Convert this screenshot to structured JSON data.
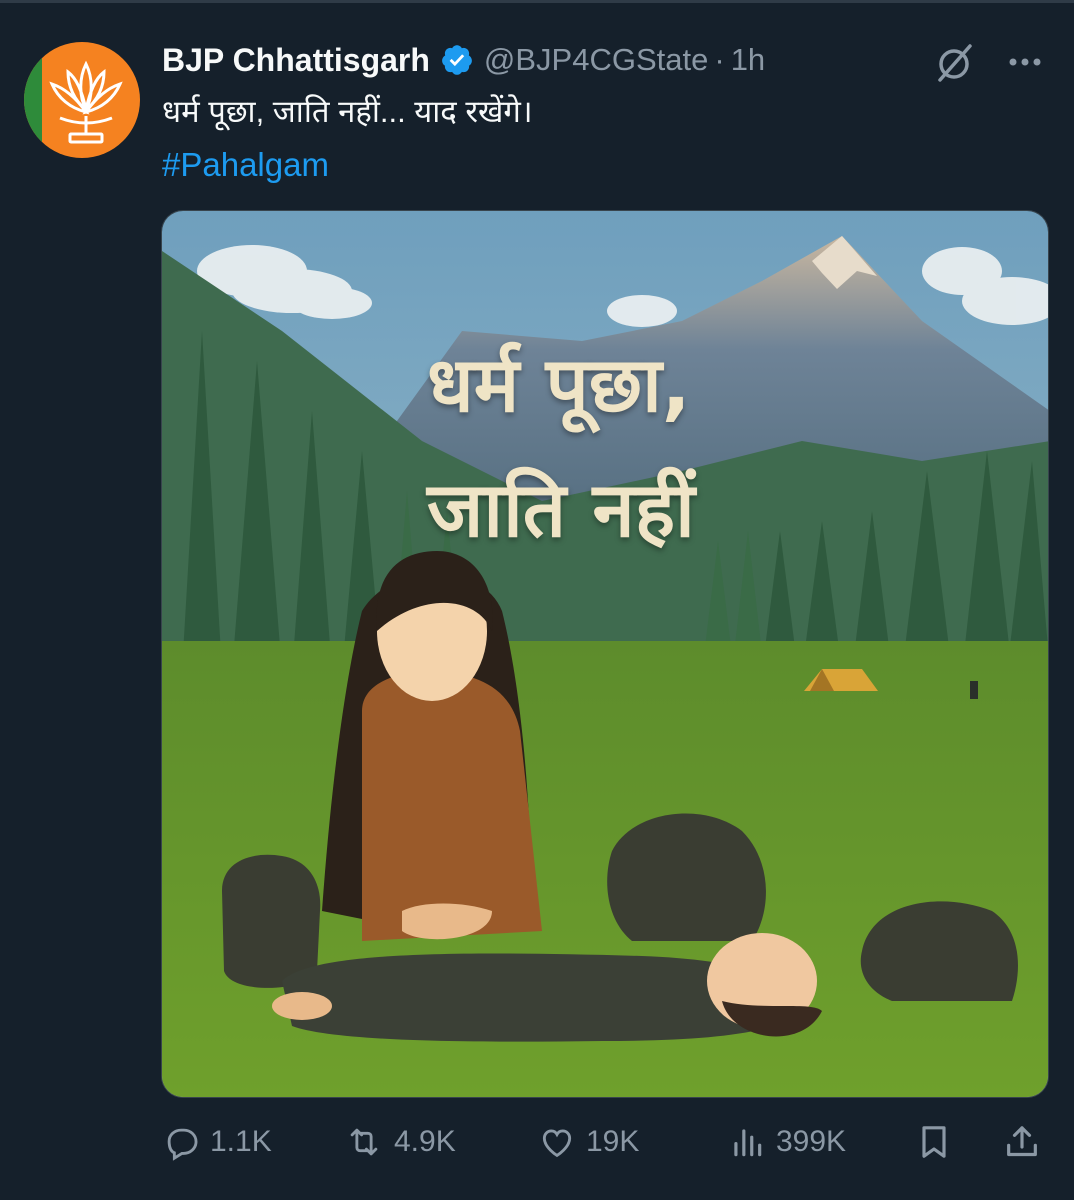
{
  "account": {
    "display_name": "BJP Chhattisgarh",
    "handle": "@BJP4CGState",
    "separator": "·",
    "time_ago": "1h",
    "verified": true
  },
  "tweet": {
    "text": "धर्म पूछा, जाति नहीं... याद रखेंगे।",
    "hashtag": "#Pahalgam"
  },
  "media": {
    "overlay_line1": "धर्म पूछा,",
    "overlay_line2": "जाति नहीं"
  },
  "actions": {
    "replies": "1.1K",
    "reposts": "4.9K",
    "likes": "19K",
    "views": "399K"
  },
  "icons": {
    "verified": "verified-badge-icon",
    "grok": "grok-icon",
    "more": "more-options-icon",
    "reply": "reply-icon",
    "repost": "repost-icon",
    "like": "heart-icon",
    "views": "views-chart-icon",
    "bookmark": "bookmark-icon",
    "share": "share-icon"
  },
  "colors": {
    "background": "#15202b",
    "primary_text": "#f7f9f9",
    "secondary_text": "#8b98a5",
    "link": "#1d9bf0",
    "avatar_bg": "#f58220"
  }
}
